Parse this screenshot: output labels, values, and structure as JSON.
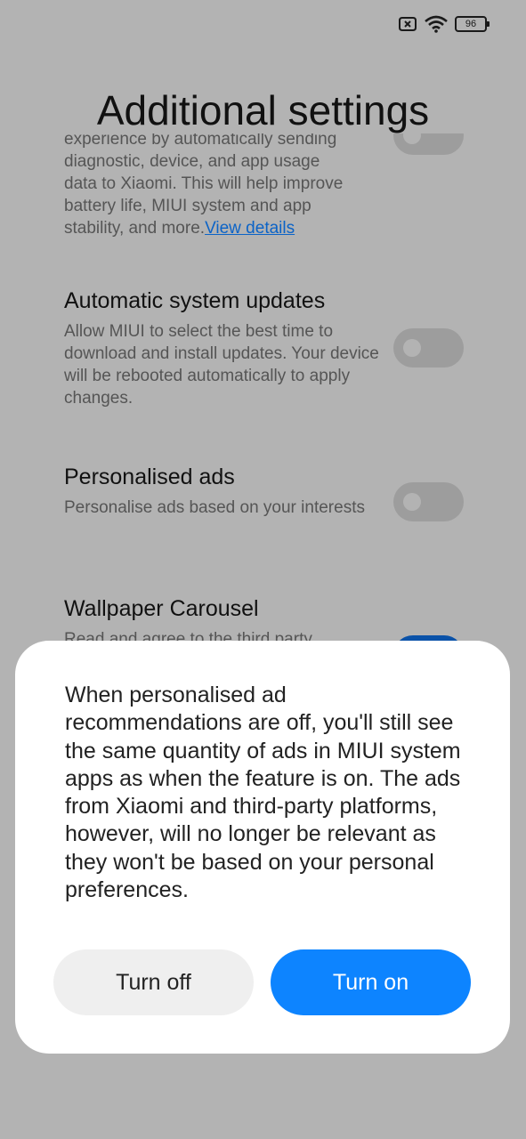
{
  "status": {
    "battery": "96",
    "icons": [
      "sim-off-icon",
      "wifi-icon",
      "battery-icon"
    ]
  },
  "page": {
    "title": "Additional settings"
  },
  "settings": [
    {
      "title": "",
      "desc_lines": [
        "experience by automatically sending",
        "diagnostic, device, and app usage",
        "data to Xiaomi. This will help improve",
        "battery life, MIUI system and app"
      ],
      "desc_last": "stability, and more.",
      "link": "View details",
      "enabled": false
    },
    {
      "title": "Automatic system updates",
      "desc": "Allow MIUI to select the best time to download and install updates. Your device will be rebooted automatically to apply changes.",
      "enabled": false
    },
    {
      "title": "Personalised ads",
      "desc": "Personalise ads based on your interests",
      "enabled": false
    },
    {
      "title": "Wallpaper Carousel",
      "desc": "Read and agree to the third party",
      "enabled": true
    }
  ],
  "dialog": {
    "message": "When personalised ad recommendations are off, you'll still see the same quantity of ads in MIUI system apps as when the feature is on. The ads from Xiaomi and third-party platforms, however, will no longer be relevant as they won't be based on your personal preferences.",
    "turn_off": "Turn off",
    "turn_on": "Turn on"
  },
  "colors": {
    "scrim": "#b3b3b3",
    "accent": "#0d84ff",
    "dialog_bg": "#ffffff"
  }
}
